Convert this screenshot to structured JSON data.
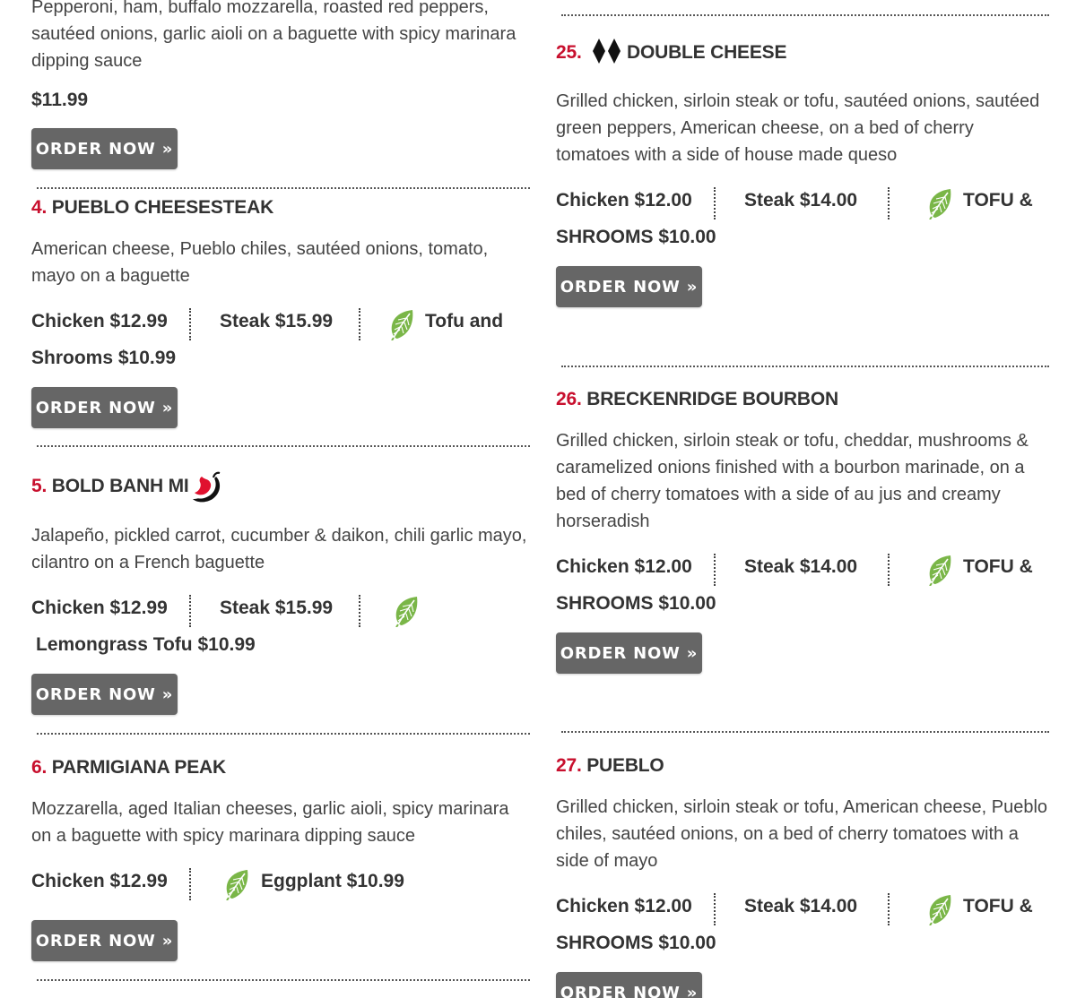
{
  "colors": {
    "accent": "#c8102e",
    "button": "#666666",
    "leaf": "#7ab648"
  },
  "left": {
    "top_item": {
      "desc": "Pepperoni, ham, buffalo mozzarella, roasted red peppers, sautéed onions, garlic aioli on a baguette with spicy marinara dipping sauce",
      "price": "$11.99",
      "button": "ORDER NOW »"
    },
    "item4": {
      "num": "4.",
      "name": "PUEBLO CHEESESTEAK",
      "desc": "American cheese, Pueblo chiles, sautéed onions, tomato, mayo on a baguette",
      "chicken": "Chicken $12.99",
      "steak": "Steak $15.99",
      "veg1": "Tofu and",
      "veg2": "Shrooms $10.99",
      "button": "ORDER NOW »"
    },
    "item5": {
      "num": "5.",
      "name": "BOLD BANH MI",
      "icon": "chili-pepper-icon",
      "desc": "Jalapeño, pickled carrot, cucumber & daikon, chili garlic mayo, cilantro on a French baguette",
      "chicken": "Chicken $12.99",
      "steak": "Steak $15.99",
      "veg": "Lemongrass Tofu $10.99",
      "button": "ORDER NOW »"
    },
    "item6": {
      "num": "6.",
      "name": "PARMIGIANA PEAK",
      "desc": "Mozzarella, aged Italian cheeses, garlic aioli, spicy marinara on a baguette with spicy marinara dipping sauce",
      "chicken": "Chicken $12.99",
      "veg": "Eggplant $10.99",
      "button": "ORDER NOW »"
    }
  },
  "right": {
    "item25": {
      "num": "25.",
      "name": "DOUBLE CHEESE",
      "icon": "double-diamond-icon",
      "desc": "Grilled chicken, sirloin steak or tofu, sautéed onions, sautéed green peppers, American cheese, on a bed of cherry tomatoes with a side of house made queso",
      "chicken": "Chicken $12.00",
      "steak": "Steak $14.00",
      "veg1": "TOFU &",
      "veg2": "SHROOMS $10.00",
      "button": "ORDER NOW »"
    },
    "item26": {
      "num": "26.",
      "name": "BRECKENRIDGE BOURBON",
      "desc": "Grilled chicken, sirloin steak or tofu, cheddar, mushrooms & caramelized onions finished with a bourbon marinade, on a bed of cherry tomatoes with a side of au jus and creamy horseradish",
      "chicken": "Chicken $12.00",
      "steak": "Steak $14.00",
      "veg1": "TOFU &",
      "veg2": "SHROOMS $10.00",
      "button": "ORDER NOW »"
    },
    "item27": {
      "num": "27.",
      "name": "PUEBLO",
      "desc": "Grilled chicken, sirloin steak or tofu, American cheese, Pueblo chiles, sautéed onions, on a bed of cherry tomatoes with a side of mayo",
      "chicken": "Chicken $12.00",
      "steak": "Steak $14.00",
      "veg1": "TOFU &",
      "veg2": "SHROOMS $10.00",
      "button": "ORDER NOW »"
    }
  }
}
